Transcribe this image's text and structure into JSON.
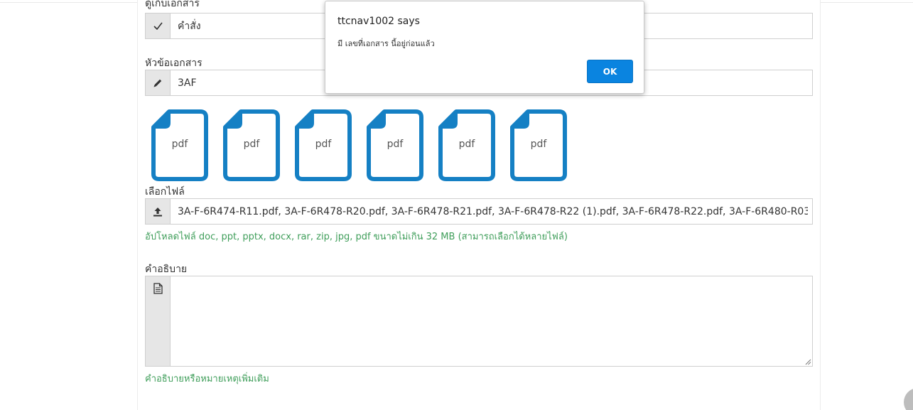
{
  "form": {
    "category": {
      "label": "ตู้เก็บเอกสาร",
      "value": "คำสั่ง",
      "icon": "check-icon"
    },
    "subject": {
      "label": "หัวข้อเอกสาร",
      "value": "3AF",
      "icon": "pencil-icon"
    },
    "attachments": [
      {
        "type": "pdf"
      },
      {
        "type": "pdf"
      },
      {
        "type": "pdf"
      },
      {
        "type": "pdf"
      },
      {
        "type": "pdf"
      },
      {
        "type": "pdf"
      }
    ],
    "file": {
      "label": "เลือกไฟล์",
      "value": "3A-F-6R474-R11.pdf, 3A-F-6R478-R20.pdf, 3A-F-6R478-R21.pdf, 3A-F-6R478-R22 (1).pdf, 3A-F-6R478-R22.pdf, 3A-F-6R480-R03",
      "help": "อัปโหลดไฟล์ doc, ppt, pptx, docx, rar, zip, jpg, pdf ขนาดไม่เกิน 32 MB (สามารถเลือกได้หลายไฟล์)",
      "icon": "upload-icon"
    },
    "description": {
      "label": "คำอธิบาย",
      "value": "",
      "help": "คำอธิบายหรือหมายเหตุเพิ่มเติม",
      "icon": "document-icon"
    }
  },
  "dialog": {
    "title": "ttcnav1002 says",
    "message": "มี เลขที่เอกสาร นี้อยู่ก่อนแล้ว",
    "ok_label": "OK"
  },
  "colors": {
    "accent": "#0a84e0",
    "pdf_icon": "#1580c4",
    "help_text": "#3f9e5a"
  }
}
